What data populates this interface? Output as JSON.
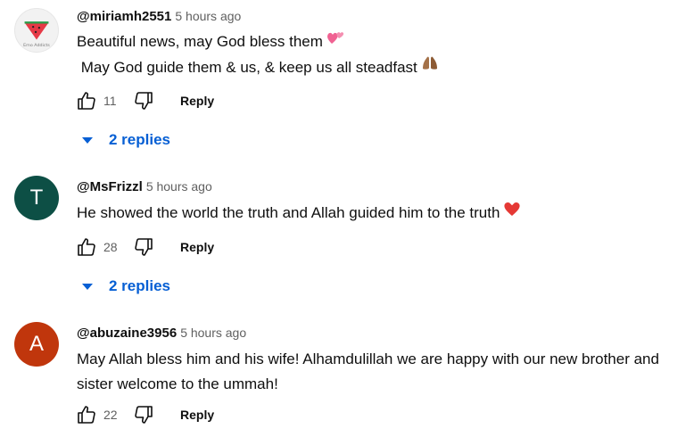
{
  "comments": [
    {
      "handle": "@miriamh2551",
      "time": "5 hours ago",
      "avatar": {
        "type": "photo",
        "logo_text": "Emo Addicts"
      },
      "lines": [
        "Beautiful news, may God bless them",
        " May God guide them & us, & keep us all steadfast"
      ],
      "line_emojis": [
        "two-hearts-icon",
        "praying-hands-icon"
      ],
      "likes": "11",
      "reply_label": "Reply",
      "replies_label": "2 replies"
    },
    {
      "handle": "@MsFrizzl",
      "time": "5 hours ago",
      "avatar": {
        "type": "letter",
        "letter": "T",
        "color": "#0d4f45"
      },
      "lines": [
        "He showed the world the truth and Allah guided him to the truth"
      ],
      "line_emojis": [
        "red-heart-icon"
      ],
      "likes": "28",
      "reply_label": "Reply",
      "replies_label": "2 replies"
    },
    {
      "handle": "@abuzaine3956",
      "time": "5 hours ago",
      "avatar": {
        "type": "letter",
        "letter": "A",
        "color": "#c0360c"
      },
      "lines": [
        "May Allah bless him and his wife! Alhamdulillah we are happy with our new brother and",
        "sister welcome to the ummah!"
      ],
      "line_emojis": [],
      "likes": "22",
      "reply_label": "Reply"
    }
  ],
  "colors": {
    "link_blue": "#065fd4",
    "secondary_text": "#606060",
    "primary_text": "#0f0f0f"
  }
}
